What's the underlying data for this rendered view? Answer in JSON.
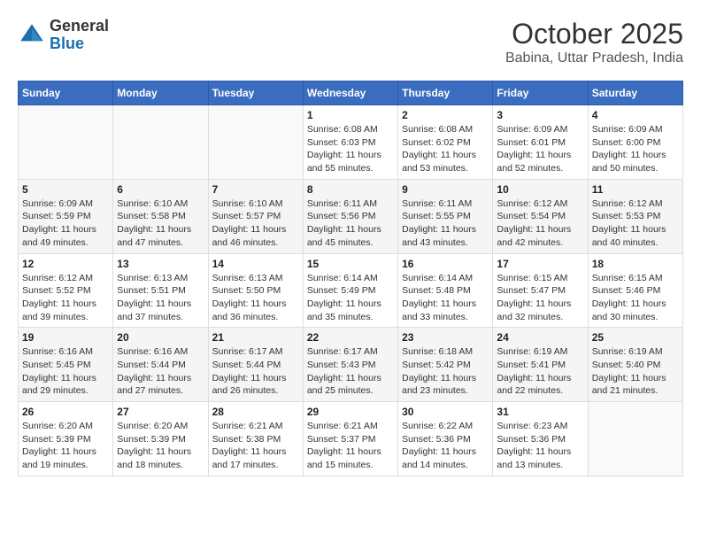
{
  "header": {
    "logo": {
      "line1": "General",
      "line2": "Blue"
    },
    "month_year": "October 2025",
    "location": "Babina, Uttar Pradesh, India"
  },
  "weekdays": [
    "Sunday",
    "Monday",
    "Tuesday",
    "Wednesday",
    "Thursday",
    "Friday",
    "Saturday"
  ],
  "weeks": [
    [
      {
        "day": "",
        "info": ""
      },
      {
        "day": "",
        "info": ""
      },
      {
        "day": "",
        "info": ""
      },
      {
        "day": "1",
        "sunrise": "6:08 AM",
        "sunset": "6:03 PM",
        "daylight": "11 hours and 55 minutes."
      },
      {
        "day": "2",
        "sunrise": "6:08 AM",
        "sunset": "6:02 PM",
        "daylight": "11 hours and 53 minutes."
      },
      {
        "day": "3",
        "sunrise": "6:09 AM",
        "sunset": "6:01 PM",
        "daylight": "11 hours and 52 minutes."
      },
      {
        "day": "4",
        "sunrise": "6:09 AM",
        "sunset": "6:00 PM",
        "daylight": "11 hours and 50 minutes."
      }
    ],
    [
      {
        "day": "5",
        "sunrise": "6:09 AM",
        "sunset": "5:59 PM",
        "daylight": "11 hours and 49 minutes."
      },
      {
        "day": "6",
        "sunrise": "6:10 AM",
        "sunset": "5:58 PM",
        "daylight": "11 hours and 47 minutes."
      },
      {
        "day": "7",
        "sunrise": "6:10 AM",
        "sunset": "5:57 PM",
        "daylight": "11 hours and 46 minutes."
      },
      {
        "day": "8",
        "sunrise": "6:11 AM",
        "sunset": "5:56 PM",
        "daylight": "11 hours and 45 minutes."
      },
      {
        "day": "9",
        "sunrise": "6:11 AM",
        "sunset": "5:55 PM",
        "daylight": "11 hours and 43 minutes."
      },
      {
        "day": "10",
        "sunrise": "6:12 AM",
        "sunset": "5:54 PM",
        "daylight": "11 hours and 42 minutes."
      },
      {
        "day": "11",
        "sunrise": "6:12 AM",
        "sunset": "5:53 PM",
        "daylight": "11 hours and 40 minutes."
      }
    ],
    [
      {
        "day": "12",
        "sunrise": "6:12 AM",
        "sunset": "5:52 PM",
        "daylight": "11 hours and 39 minutes."
      },
      {
        "day": "13",
        "sunrise": "6:13 AM",
        "sunset": "5:51 PM",
        "daylight": "11 hours and 37 minutes."
      },
      {
        "day": "14",
        "sunrise": "6:13 AM",
        "sunset": "5:50 PM",
        "daylight": "11 hours and 36 minutes."
      },
      {
        "day": "15",
        "sunrise": "6:14 AM",
        "sunset": "5:49 PM",
        "daylight": "11 hours and 35 minutes."
      },
      {
        "day": "16",
        "sunrise": "6:14 AM",
        "sunset": "5:48 PM",
        "daylight": "11 hours and 33 minutes."
      },
      {
        "day": "17",
        "sunrise": "6:15 AM",
        "sunset": "5:47 PM",
        "daylight": "11 hours and 32 minutes."
      },
      {
        "day": "18",
        "sunrise": "6:15 AM",
        "sunset": "5:46 PM",
        "daylight": "11 hours and 30 minutes."
      }
    ],
    [
      {
        "day": "19",
        "sunrise": "6:16 AM",
        "sunset": "5:45 PM",
        "daylight": "11 hours and 29 minutes."
      },
      {
        "day": "20",
        "sunrise": "6:16 AM",
        "sunset": "5:44 PM",
        "daylight": "11 hours and 27 minutes."
      },
      {
        "day": "21",
        "sunrise": "6:17 AM",
        "sunset": "5:44 PM",
        "daylight": "11 hours and 26 minutes."
      },
      {
        "day": "22",
        "sunrise": "6:17 AM",
        "sunset": "5:43 PM",
        "daylight": "11 hours and 25 minutes."
      },
      {
        "day": "23",
        "sunrise": "6:18 AM",
        "sunset": "5:42 PM",
        "daylight": "11 hours and 23 minutes."
      },
      {
        "day": "24",
        "sunrise": "6:19 AM",
        "sunset": "5:41 PM",
        "daylight": "11 hours and 22 minutes."
      },
      {
        "day": "25",
        "sunrise": "6:19 AM",
        "sunset": "5:40 PM",
        "daylight": "11 hours and 21 minutes."
      }
    ],
    [
      {
        "day": "26",
        "sunrise": "6:20 AM",
        "sunset": "5:39 PM",
        "daylight": "11 hours and 19 minutes."
      },
      {
        "day": "27",
        "sunrise": "6:20 AM",
        "sunset": "5:39 PM",
        "daylight": "11 hours and 18 minutes."
      },
      {
        "day": "28",
        "sunrise": "6:21 AM",
        "sunset": "5:38 PM",
        "daylight": "11 hours and 17 minutes."
      },
      {
        "day": "29",
        "sunrise": "6:21 AM",
        "sunset": "5:37 PM",
        "daylight": "11 hours and 15 minutes."
      },
      {
        "day": "30",
        "sunrise": "6:22 AM",
        "sunset": "5:36 PM",
        "daylight": "11 hours and 14 minutes."
      },
      {
        "day": "31",
        "sunrise": "6:23 AM",
        "sunset": "5:36 PM",
        "daylight": "11 hours and 13 minutes."
      },
      {
        "day": "",
        "info": ""
      }
    ]
  ]
}
